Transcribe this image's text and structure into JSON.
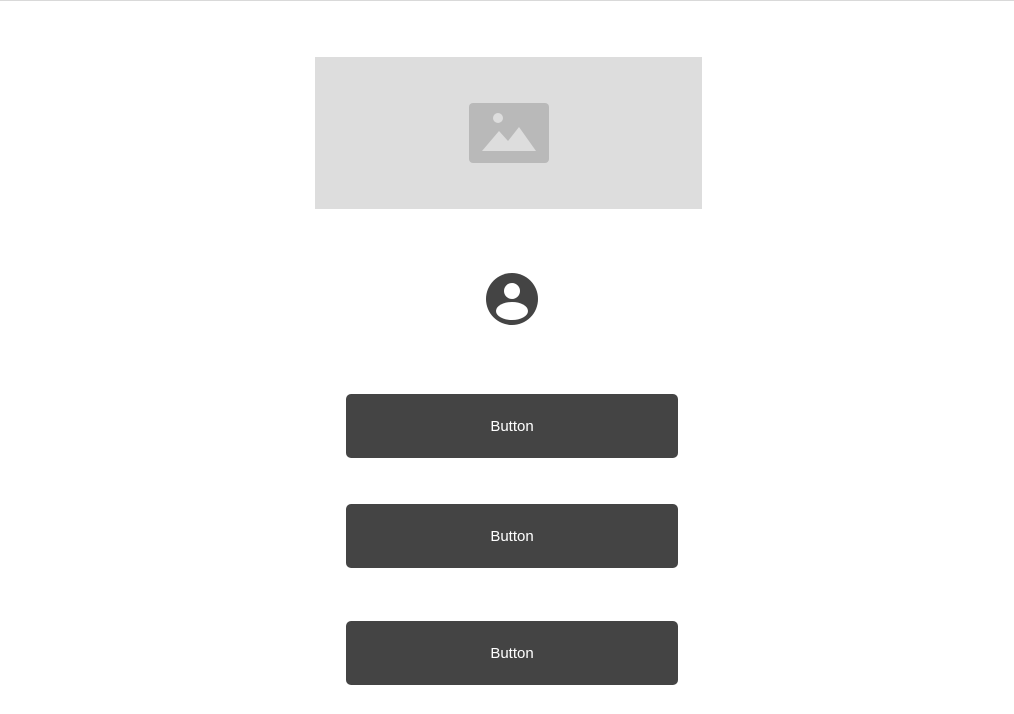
{
  "placeholder": {
    "background_color": "#dddddd",
    "icon": "image-icon",
    "icon_color": "#b9b9b9"
  },
  "avatar": {
    "icon": "user-avatar-icon",
    "color": "#444444"
  },
  "buttons": [
    {
      "label": "Button"
    },
    {
      "label": "Button"
    },
    {
      "label": "Button"
    }
  ],
  "colors": {
    "button_background": "#444444",
    "button_text": "#ffffff",
    "page_background": "#ffffff"
  }
}
